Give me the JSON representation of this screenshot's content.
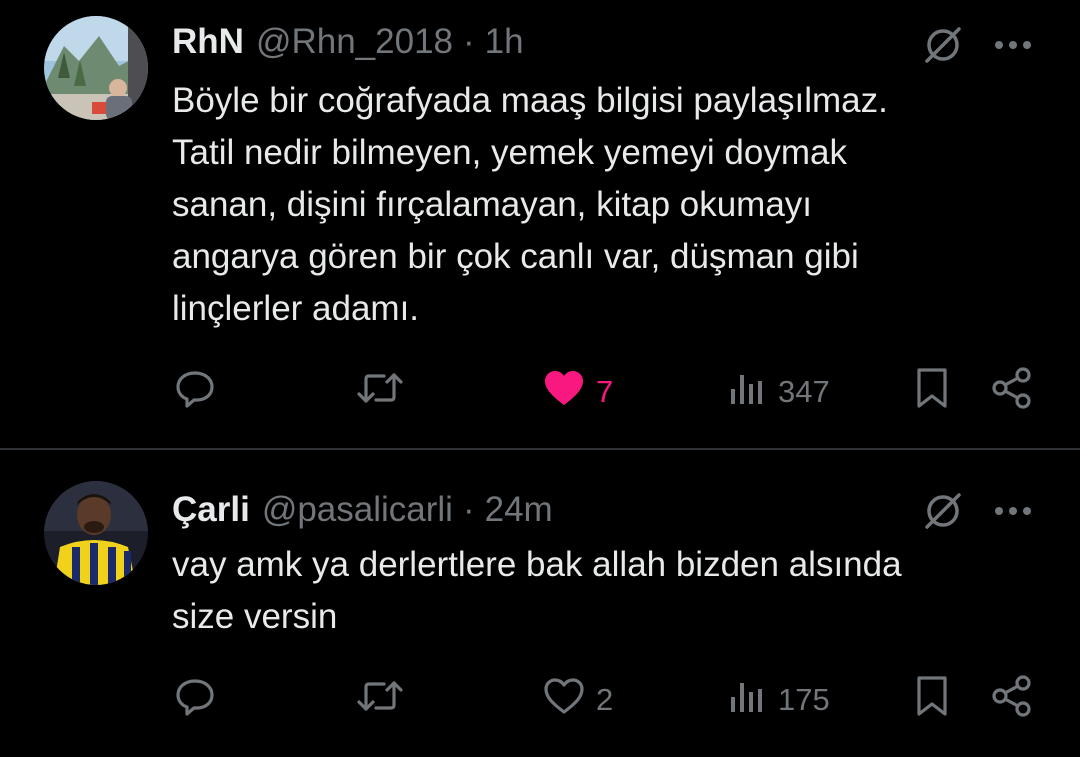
{
  "colors": {
    "background": "#000000",
    "text_primary": "#e7e9ea",
    "text_secondary": "#71767b",
    "like_active": "#f91880",
    "divider": "#2f3336"
  },
  "tweets": [
    {
      "display_name": "RhN",
      "handle": "@Rhn_2018",
      "separator": "·",
      "time": "1h",
      "lines": [
        "Böyle bir coğrafyada maaş bilgisi paylaşılmaz.",
        "Tatil nedir bilmeyen, yemek yemeyi doymak",
        "sanan, dişini fırçalamayan, kitap okumayı",
        "angarya gören bir çok canlı var, düşman gibi",
        "linçlerler adamı."
      ],
      "likes": "7",
      "liked": true,
      "views": "347",
      "icons": [
        "grok-icon",
        "more-icon",
        "reply-icon",
        "retweet-icon",
        "heart-icon",
        "views-icon",
        "bookmark-icon",
        "share-icon"
      ]
    },
    {
      "display_name": "Çarli",
      "handle": "@pasalicarli",
      "separator": "·",
      "time": "24m",
      "lines": [
        "vay amk ya derlertlere bak allah bizden alsında",
        "size versin"
      ],
      "likes": "2",
      "liked": false,
      "views": "175",
      "icons": [
        "grok-icon",
        "more-icon",
        "reply-icon",
        "retweet-icon",
        "heart-icon",
        "views-icon",
        "bookmark-icon",
        "share-icon"
      ]
    }
  ]
}
